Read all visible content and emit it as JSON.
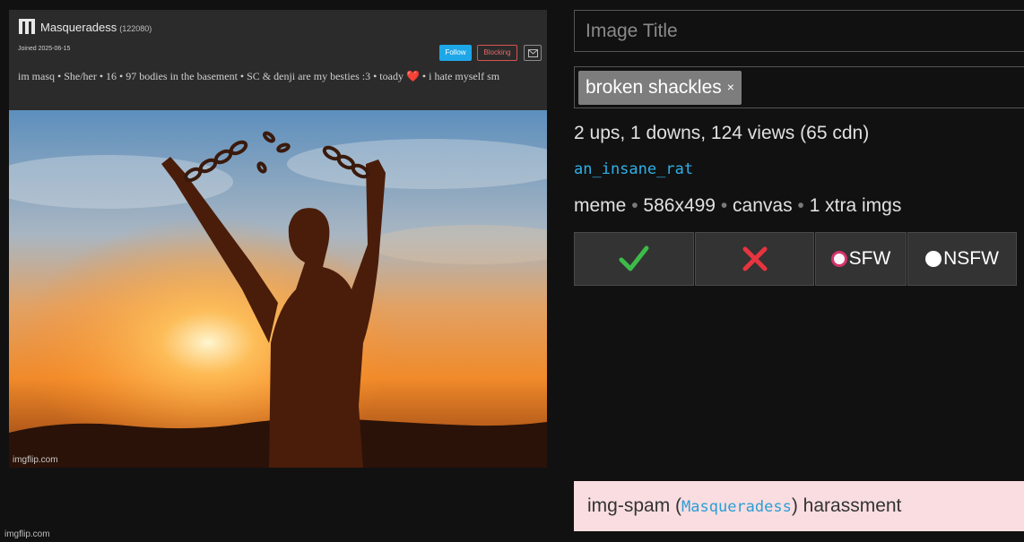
{
  "meme": {
    "profile": {
      "logo_glyph": "ἰΊ",
      "username": "Masqueradess",
      "points": "(122080)",
      "joined": "Joined 2025-06-15",
      "follow_label": "Follow",
      "blocking_label": "Blocking",
      "bio_before_heart": "im masq • She/her • 16 • 97 bodies in the basement • SC & denji are my besties :3 • toady ",
      "bio_heart": "❤️",
      "bio_after_heart": " • i hate myself sm"
    },
    "photo_description_icon": "man-breaking-chains-sunset-image",
    "watermark_inner": "imgflip.com"
  },
  "watermark_outer": "imgflip.com",
  "form": {
    "title_placeholder": "Image Title",
    "title_value": "",
    "tags": [
      {
        "label": "broken shackles",
        "remove": "×"
      }
    ],
    "stats": "2 ups, 1 downs, 124 views (65 cdn)",
    "uploader": "an_insane_rat",
    "meta": {
      "type": "meme",
      "dimensions": "586x499",
      "mode": "canvas",
      "extra": "1 xtra imgs",
      "separator": "•"
    }
  },
  "moderation": {
    "approve_icon": "check-mark-icon",
    "reject_icon": "cross-mark-icon",
    "approve_color": "#3dbb4a",
    "reject_color": "#e8343f",
    "sfw_label": "SFW",
    "nsfw_label": "NSFW",
    "sfw_selected": true,
    "radio_accent": "#d6336c"
  },
  "report": {
    "prefix": "img-spam (",
    "user": "Masqueradess",
    "suffix": ") harassment",
    "background": "#f9dde0"
  }
}
